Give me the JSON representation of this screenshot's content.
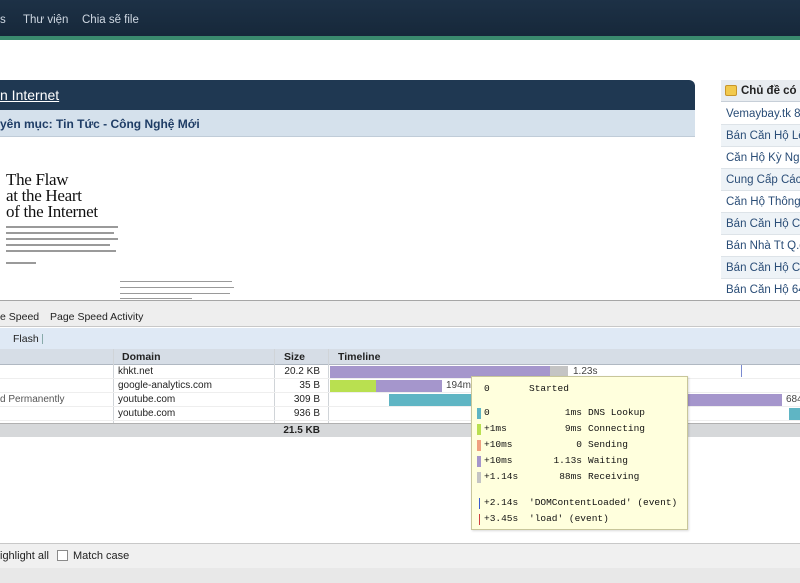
{
  "topnav": {
    "items": [
      "s",
      "Thư viện",
      "Chia sẽ file"
    ]
  },
  "article": {
    "title_link": "n Internet",
    "category": "yên mục: Tin Tức - Công Nghệ Mới",
    "magazine": {
      "title_lines": [
        "The Flaw",
        "at the Heart",
        "of the Internet"
      ],
      "caption": "DAN KAMINSKY DISCOVERED A FUNDAMENTAL SECURITY PROBLEM IN THE INTERNET"
    }
  },
  "sidebar": {
    "heading": "Chủ đề có",
    "items": [
      "Vemaybay.tk 8",
      "Bán Căn Hộ Lê",
      "Căn Hộ Kỳ Ngu",
      "Cung Cấp Các",
      "Căn Hộ Thông",
      "Bán Căn Hộ Ca",
      "Bán Nhà Tt Q.g",
      "Bán Căn Hộ Ca",
      "Bán Căn Hộ 64"
    ]
  },
  "firebug": {
    "tabs": [
      "e Speed",
      "Page Speed Activity"
    ],
    "subtab": "Flash",
    "columns": {
      "domain": "Domain",
      "size": "Size",
      "timeline": "Timeline"
    },
    "rows": [
      {
        "status": "",
        "domain": "khkt.net",
        "size": "20.2 KB",
        "time_label": "1.23s"
      },
      {
        "status": "",
        "domain": "google-analytics.com",
        "size": "35 B",
        "time_label": "194ms"
      },
      {
        "status": "d Permanently",
        "domain": "youtube.com",
        "size": "309 B",
        "time_label": "684"
      },
      {
        "status": "",
        "domain": "youtube.com",
        "size": "936 B",
        "time_label": ""
      }
    ],
    "total_size": "21.5 KB",
    "colors": {
      "dns": "#5fb5c4",
      "connecting": "#b9e050",
      "sending": "#f0a080",
      "waiting": "#a596cc",
      "receiving": "#c4c4c4"
    }
  },
  "tooltip": {
    "rows": [
      {
        "offset": "0",
        "duration": "",
        "label": "Started"
      },
      {
        "offset": "0",
        "duration": "1ms",
        "label": "DNS Lookup"
      },
      {
        "offset": "+1ms",
        "duration": "9ms",
        "label": "Connecting"
      },
      {
        "offset": "+10ms",
        "duration": "0",
        "label": "Sending"
      },
      {
        "offset": "+10ms",
        "duration": "1.13s",
        "label": "Waiting"
      },
      {
        "offset": "+1.14s",
        "duration": "88ms",
        "label": "Receiving"
      }
    ],
    "events": [
      {
        "offset": "+2.14s",
        "label": "'DOMContentLoaded' (event)"
      },
      {
        "offset": "+3.45s",
        "label": "'load' (event)"
      }
    ]
  },
  "findbar": {
    "highlight_all": "ighlight all",
    "match_case": "Match case"
  }
}
